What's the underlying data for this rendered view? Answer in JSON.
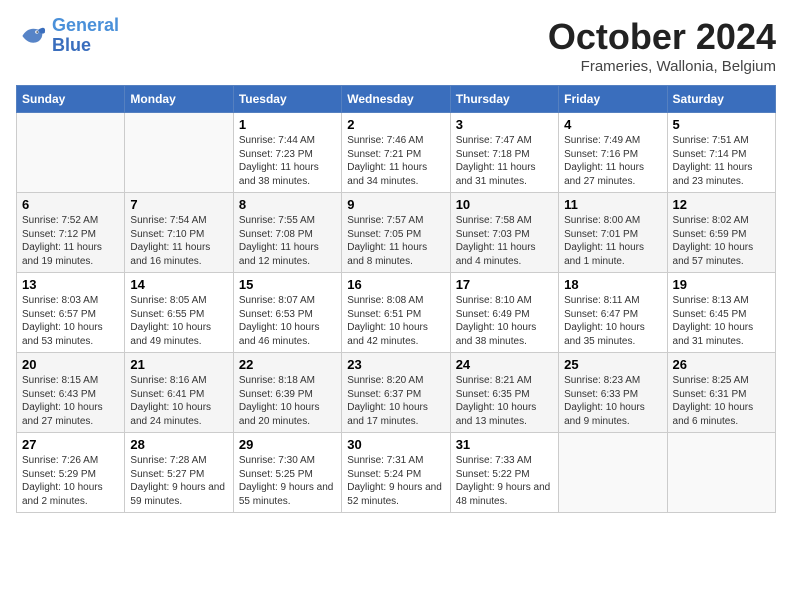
{
  "logo": {
    "line1": "General",
    "line2": "Blue"
  },
  "title": "October 2024",
  "subtitle": "Frameries, Wallonia, Belgium",
  "days_header": [
    "Sunday",
    "Monday",
    "Tuesday",
    "Wednesday",
    "Thursday",
    "Friday",
    "Saturday"
  ],
  "weeks": [
    [
      {
        "day": "",
        "info": ""
      },
      {
        "day": "",
        "info": ""
      },
      {
        "day": "1",
        "info": "Sunrise: 7:44 AM\nSunset: 7:23 PM\nDaylight: 11 hours and 38 minutes."
      },
      {
        "day": "2",
        "info": "Sunrise: 7:46 AM\nSunset: 7:21 PM\nDaylight: 11 hours and 34 minutes."
      },
      {
        "day": "3",
        "info": "Sunrise: 7:47 AM\nSunset: 7:18 PM\nDaylight: 11 hours and 31 minutes."
      },
      {
        "day": "4",
        "info": "Sunrise: 7:49 AM\nSunset: 7:16 PM\nDaylight: 11 hours and 27 minutes."
      },
      {
        "day": "5",
        "info": "Sunrise: 7:51 AM\nSunset: 7:14 PM\nDaylight: 11 hours and 23 minutes."
      }
    ],
    [
      {
        "day": "6",
        "info": "Sunrise: 7:52 AM\nSunset: 7:12 PM\nDaylight: 11 hours and 19 minutes."
      },
      {
        "day": "7",
        "info": "Sunrise: 7:54 AM\nSunset: 7:10 PM\nDaylight: 11 hours and 16 minutes."
      },
      {
        "day": "8",
        "info": "Sunrise: 7:55 AM\nSunset: 7:08 PM\nDaylight: 11 hours and 12 minutes."
      },
      {
        "day": "9",
        "info": "Sunrise: 7:57 AM\nSunset: 7:05 PM\nDaylight: 11 hours and 8 minutes."
      },
      {
        "day": "10",
        "info": "Sunrise: 7:58 AM\nSunset: 7:03 PM\nDaylight: 11 hours and 4 minutes."
      },
      {
        "day": "11",
        "info": "Sunrise: 8:00 AM\nSunset: 7:01 PM\nDaylight: 11 hours and 1 minute."
      },
      {
        "day": "12",
        "info": "Sunrise: 8:02 AM\nSunset: 6:59 PM\nDaylight: 10 hours and 57 minutes."
      }
    ],
    [
      {
        "day": "13",
        "info": "Sunrise: 8:03 AM\nSunset: 6:57 PM\nDaylight: 10 hours and 53 minutes."
      },
      {
        "day": "14",
        "info": "Sunrise: 8:05 AM\nSunset: 6:55 PM\nDaylight: 10 hours and 49 minutes."
      },
      {
        "day": "15",
        "info": "Sunrise: 8:07 AM\nSunset: 6:53 PM\nDaylight: 10 hours and 46 minutes."
      },
      {
        "day": "16",
        "info": "Sunrise: 8:08 AM\nSunset: 6:51 PM\nDaylight: 10 hours and 42 minutes."
      },
      {
        "day": "17",
        "info": "Sunrise: 8:10 AM\nSunset: 6:49 PM\nDaylight: 10 hours and 38 minutes."
      },
      {
        "day": "18",
        "info": "Sunrise: 8:11 AM\nSunset: 6:47 PM\nDaylight: 10 hours and 35 minutes."
      },
      {
        "day": "19",
        "info": "Sunrise: 8:13 AM\nSunset: 6:45 PM\nDaylight: 10 hours and 31 minutes."
      }
    ],
    [
      {
        "day": "20",
        "info": "Sunrise: 8:15 AM\nSunset: 6:43 PM\nDaylight: 10 hours and 27 minutes."
      },
      {
        "day": "21",
        "info": "Sunrise: 8:16 AM\nSunset: 6:41 PM\nDaylight: 10 hours and 24 minutes."
      },
      {
        "day": "22",
        "info": "Sunrise: 8:18 AM\nSunset: 6:39 PM\nDaylight: 10 hours and 20 minutes."
      },
      {
        "day": "23",
        "info": "Sunrise: 8:20 AM\nSunset: 6:37 PM\nDaylight: 10 hours and 17 minutes."
      },
      {
        "day": "24",
        "info": "Sunrise: 8:21 AM\nSunset: 6:35 PM\nDaylight: 10 hours and 13 minutes."
      },
      {
        "day": "25",
        "info": "Sunrise: 8:23 AM\nSunset: 6:33 PM\nDaylight: 10 hours and 9 minutes."
      },
      {
        "day": "26",
        "info": "Sunrise: 8:25 AM\nSunset: 6:31 PM\nDaylight: 10 hours and 6 minutes."
      }
    ],
    [
      {
        "day": "27",
        "info": "Sunrise: 7:26 AM\nSunset: 5:29 PM\nDaylight: 10 hours and 2 minutes."
      },
      {
        "day": "28",
        "info": "Sunrise: 7:28 AM\nSunset: 5:27 PM\nDaylight: 9 hours and 59 minutes."
      },
      {
        "day": "29",
        "info": "Sunrise: 7:30 AM\nSunset: 5:25 PM\nDaylight: 9 hours and 55 minutes."
      },
      {
        "day": "30",
        "info": "Sunrise: 7:31 AM\nSunset: 5:24 PM\nDaylight: 9 hours and 52 minutes."
      },
      {
        "day": "31",
        "info": "Sunrise: 7:33 AM\nSunset: 5:22 PM\nDaylight: 9 hours and 48 minutes."
      },
      {
        "day": "",
        "info": ""
      },
      {
        "day": "",
        "info": ""
      }
    ]
  ]
}
